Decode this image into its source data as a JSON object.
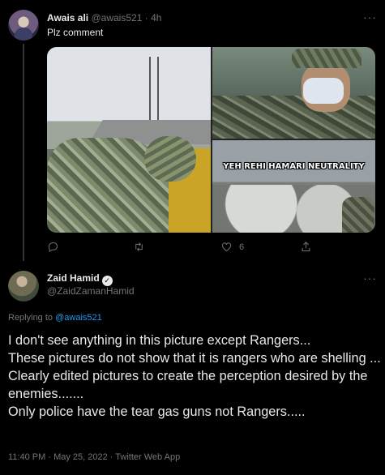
{
  "tweet1": {
    "author_name": "Awais ali",
    "author_handle": "@awais521",
    "separator": "·",
    "time": "4h",
    "text": "Plz comment",
    "image_caption": "YEH REHI HAMARI NEUTRALITY",
    "actions": {
      "reply_icon": "reply-icon",
      "retweet_icon": "retweet-icon",
      "like_icon": "heart-icon",
      "like_count": "6",
      "share_icon": "share-icon"
    }
  },
  "tweet2": {
    "author_name": "Zaid Hamid",
    "verified_icon": "verified-badge-icon",
    "author_handle": "@ZaidZamanHamid",
    "replying_to_label": "Replying to",
    "replying_to_handle": "@awais521",
    "lines": [
      "I don't see anything in this picture except Rangers...",
      "These pictures do not show that it is rangers who are shelling ...",
      "Clearly edited pictures to create the perception desired by the enemies.......",
      "Only police have the tear gas guns not Rangers....."
    ],
    "time": "11:40 PM",
    "date": "May 25, 2022",
    "client": "Twitter Web App",
    "meta_separator": " · "
  },
  "colors": {
    "background": "#000000",
    "text": "#e7e9ea",
    "muted": "#71767b",
    "link": "#1d9bf0"
  }
}
